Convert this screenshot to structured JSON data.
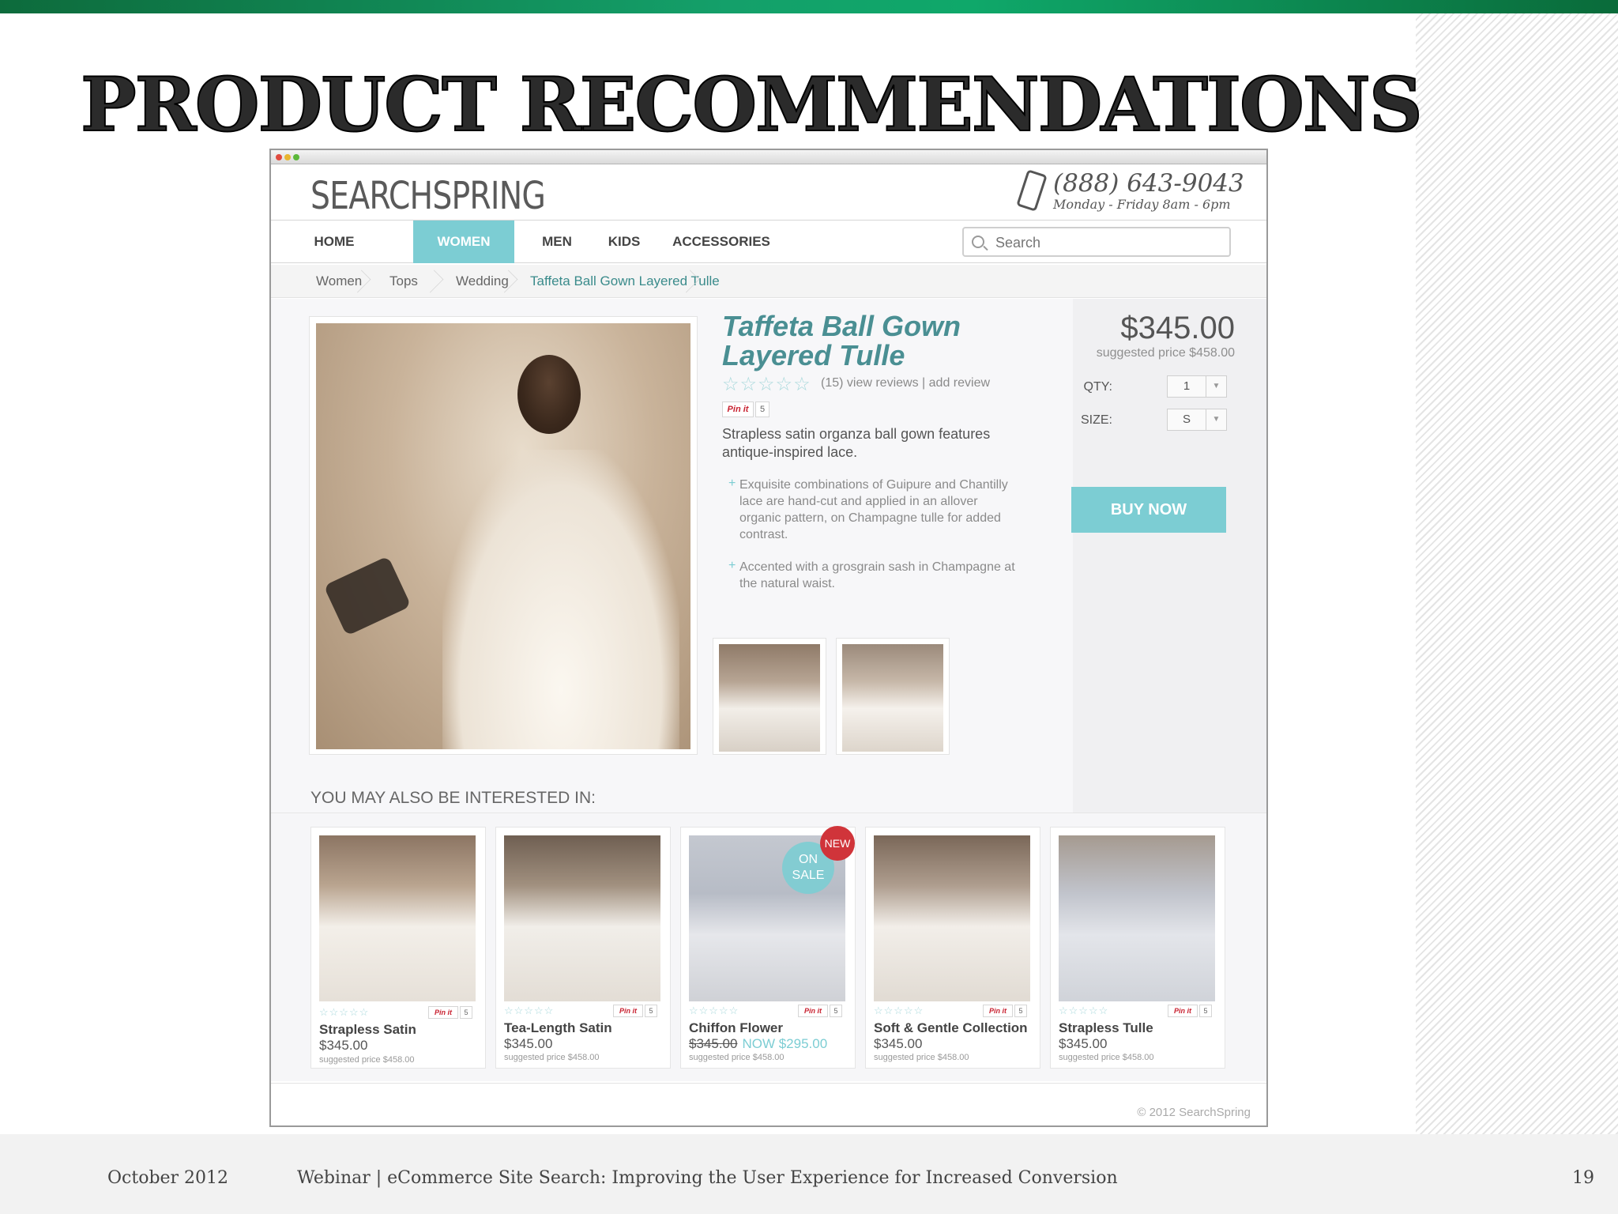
{
  "slide": {
    "title": "PRODUCT RECOMMENDATIONS",
    "footer_date": "October 2012",
    "footer_webinar": "Webinar | eCommerce Site Search: Improving the User Experience for Increased Conversion",
    "page_number": "19"
  },
  "site": {
    "logo": "SEARCHSPRING",
    "phone": "(888) 643-9043",
    "hours": "Monday - Friday 8am - 6pm",
    "nav": [
      "HOME",
      "WOMEN",
      "MEN",
      "KIDS",
      "ACCESSORIES"
    ],
    "nav_active": "WOMEN",
    "search_placeholder": "Search",
    "breadcrumbs": [
      "Women",
      "Tops",
      "Wedding",
      "Taffeta Ball Gown Layered Tulle"
    ],
    "copyright": "© 2012 SearchSpring"
  },
  "product": {
    "title": "Taffeta Ball Gown Layered Tulle",
    "stars": "☆☆☆☆☆",
    "reviews_count": "(15) view reviews",
    "add_review": "add review",
    "pin_label": "Pin it",
    "pin_count": "5",
    "description": "Strapless satin organza ball gown features antique-inspired lace.",
    "bullets": [
      "Exquisite combinations of Guipure and Chantilly lace are hand-cut and applied in an allover organic pattern, on Champagne tulle for added contrast.",
      "Accented with a grosgrain sash in Champagne at the natural waist."
    ],
    "price": "$345.00",
    "suggested_price": "suggested price $458.00",
    "qty_label": "QTY:",
    "qty_value": "1",
    "size_label": "SIZE:",
    "size_value": "S",
    "buy_label": "BUY NOW"
  },
  "recommendations": {
    "heading": "YOU MAY ALSO BE INTERESTED IN:",
    "items": [
      {
        "name": "Strapless Satin",
        "price": "$345.00",
        "suggested": "suggested price $458.00"
      },
      {
        "name": "Tea-Length Satin",
        "price": "$345.00",
        "suggested": "suggested price $458.00"
      },
      {
        "name": "Chiffon Flower",
        "price": "$345.00",
        "sale_price": "NOW $295.00",
        "suggested": "suggested price $458.00",
        "badge_new": "NEW",
        "badge_sale": "ON SALE"
      },
      {
        "name": "Soft & Gentle Collection",
        "price": "$345.00",
        "suggested": "suggested price $458.00"
      },
      {
        "name": "Strapless Tulle",
        "price": "$345.00",
        "suggested": "suggested price $458.00"
      }
    ]
  },
  "colors": {
    "accent": "#7ccdd3",
    "title_teal": "#4a8f93",
    "pin_red": "#c8202f",
    "badge_red": "#d0343a"
  }
}
